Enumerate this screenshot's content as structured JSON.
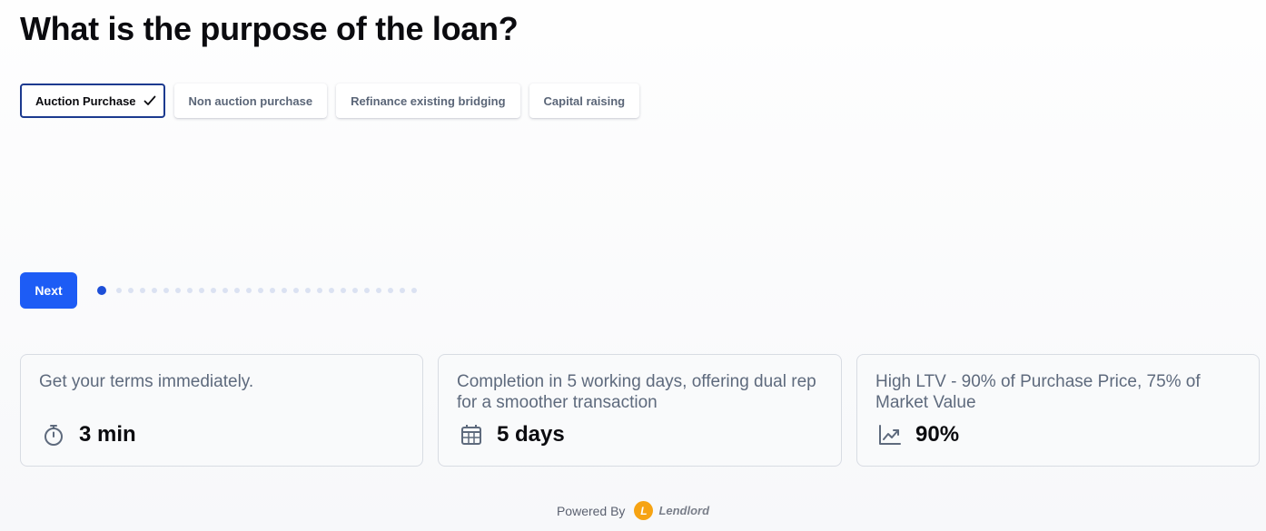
{
  "question": {
    "title": "What is the purpose of the loan?"
  },
  "options": [
    {
      "label": "Auction Purchase",
      "selected": true
    },
    {
      "label": "Non auction purchase",
      "selected": false
    },
    {
      "label": "Refinance existing bridging",
      "selected": false
    },
    {
      "label": "Capital raising",
      "selected": false
    }
  ],
  "navigation": {
    "next_label": "Next",
    "progress": {
      "current_step": 1,
      "total_steps": 27
    }
  },
  "features": [
    {
      "description": "Get your terms immediately.",
      "value": "3 min",
      "icon": "stopwatch-icon"
    },
    {
      "description": "Completion in 5 working days, offering dual rep for a smoother transaction",
      "value": "5 days",
      "icon": "calendar-icon"
    },
    {
      "description": "High LTV - 90% of Purchase Price, 75% of Market Value",
      "value": "90%",
      "icon": "trending-up-chart-icon"
    }
  ],
  "footer": {
    "powered_by": "Powered By",
    "brand_name": "Lendlord",
    "brand_mark": "L"
  },
  "colors": {
    "primary": "#1d5cf5",
    "selected_border": "#1c3a8f",
    "brand": "#f6a313",
    "muted_text": "#5e6a7d"
  }
}
